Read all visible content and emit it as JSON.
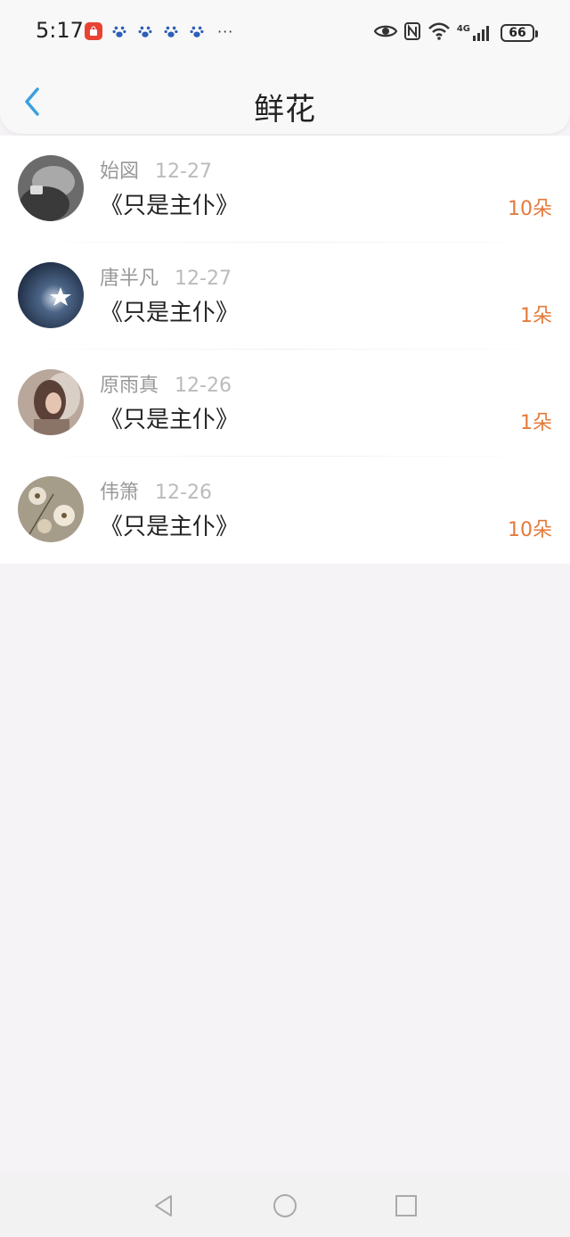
{
  "status_bar": {
    "time": "5:17",
    "signal_label": "4G",
    "battery": "66",
    "more": "···"
  },
  "header": {
    "title": "鲜花",
    "back_icon": "chevron-left-icon"
  },
  "list": [
    {
      "name": "始図",
      "date": "12-27",
      "title": "《只是主仆》",
      "count": "10朵"
    },
    {
      "name": "唐半凡",
      "date": "12-27",
      "title": "《只是主仆》",
      "count": "1朵"
    },
    {
      "name": "原雨真",
      "date": "12-26",
      "title": "《只是主仆》",
      "count": "1朵"
    },
    {
      "name": "伟箫",
      "date": "12-26",
      "title": "《只是主仆》",
      "count": "10朵"
    }
  ],
  "colors": {
    "accent": "#3aa0e0",
    "count": "#e47a3a"
  },
  "system_nav": [
    "back-triangle-icon",
    "home-circle-icon",
    "recents-square-icon"
  ]
}
